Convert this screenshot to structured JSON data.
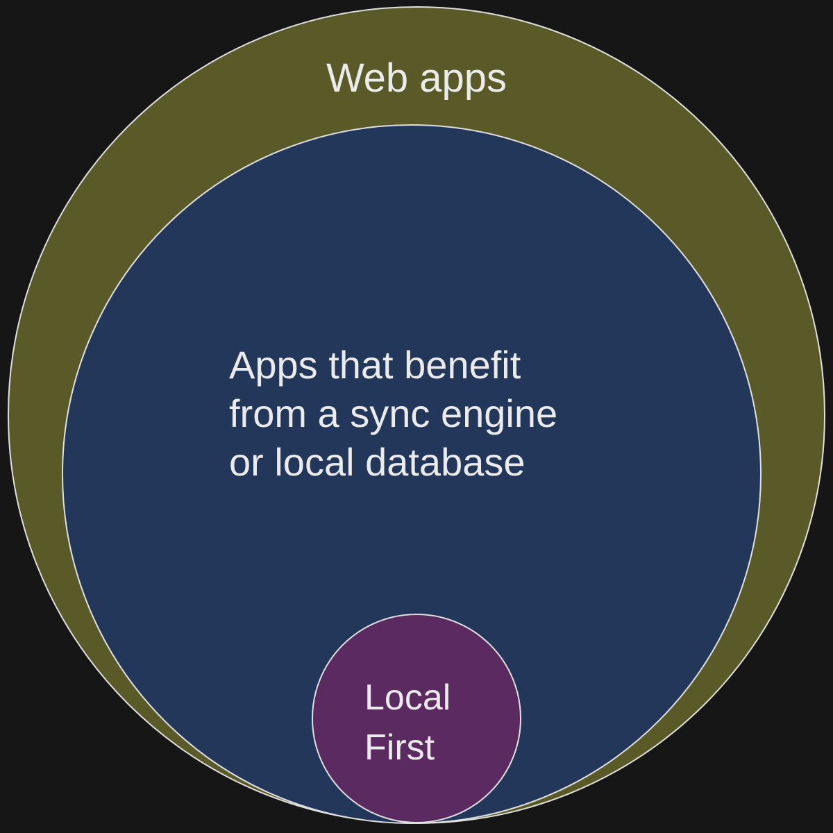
{
  "diagram": {
    "type": "nested-euler",
    "colors": {
      "background": "#161616",
      "web_apps": "#5a5a29",
      "sync_engine_apps": "#23375a",
      "local_first": "#5b2a61",
      "outline": "#e0e0e0",
      "text": "#ebebeb"
    },
    "sets": [
      {
        "id": "web_apps",
        "label_lines": [
          "Web apps"
        ]
      },
      {
        "id": "sync_engine_apps",
        "label_lines": [
          "Apps that benefit",
          "from a sync engine",
          "or local database"
        ]
      },
      {
        "id": "local_first",
        "label_lines": [
          "Local",
          "First"
        ]
      }
    ]
  }
}
